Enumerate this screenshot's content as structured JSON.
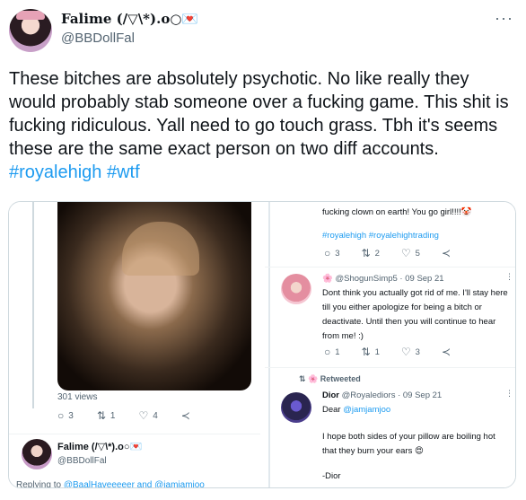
{
  "tweet": {
    "display_name": "Falime (/▽\\*).o○💌",
    "handle": "@BBDollFal",
    "more_label": "···",
    "text": "These bitches are absolutely psychotic. No like really they would probably stab someone over a fucking game. This shit is fucking ridiculous.  Yall need to go touch grass. Tbh it's seems these are the same exact person on two diff accounts. ",
    "hashtag1": "#royalehigh",
    "hashtag2": "#wtf"
  },
  "left_shot": {
    "views": "301 views",
    "stats": {
      "replies": "3",
      "retweets": "1",
      "likes": "4"
    },
    "reply_name": "Falime (/▽\\*).o○💌",
    "reply_handle": "@BBDollFal",
    "replying_prefix": "Replying to ",
    "replying_to": "@BaalHaveeeeer and @jamjamjoo"
  },
  "right_shot": {
    "top_text": "fucking clown on earth! You go girl!!!!🤡",
    "top_tags": "#royalehigh #royalehightrading",
    "top_stats": {
      "replies": "3",
      "retweets": "2",
      "likes": "5"
    },
    "reply1": {
      "name": "🌸 @ShogunSimp5 · 09 Sep 21",
      "text": "Dont think you actually got rid of me. I'll stay here till you either apologize for being a bitch or deactivate. Until then you will continue to hear from me! :)",
      "stats": {
        "replies": "1",
        "retweets": "1",
        "likes": "3"
      }
    },
    "retweeted_label": "🌸 Retweeted",
    "reply2": {
      "name": "Dior",
      "meta": " @Royalediors · 09 Sep 21",
      "dear": "Dear ",
      "dear_handle": "@jamjamjoo",
      "body": "I hope both sides of your pillow are boiling hot that they burn your ears 😍",
      "sign": "-Dior"
    }
  }
}
